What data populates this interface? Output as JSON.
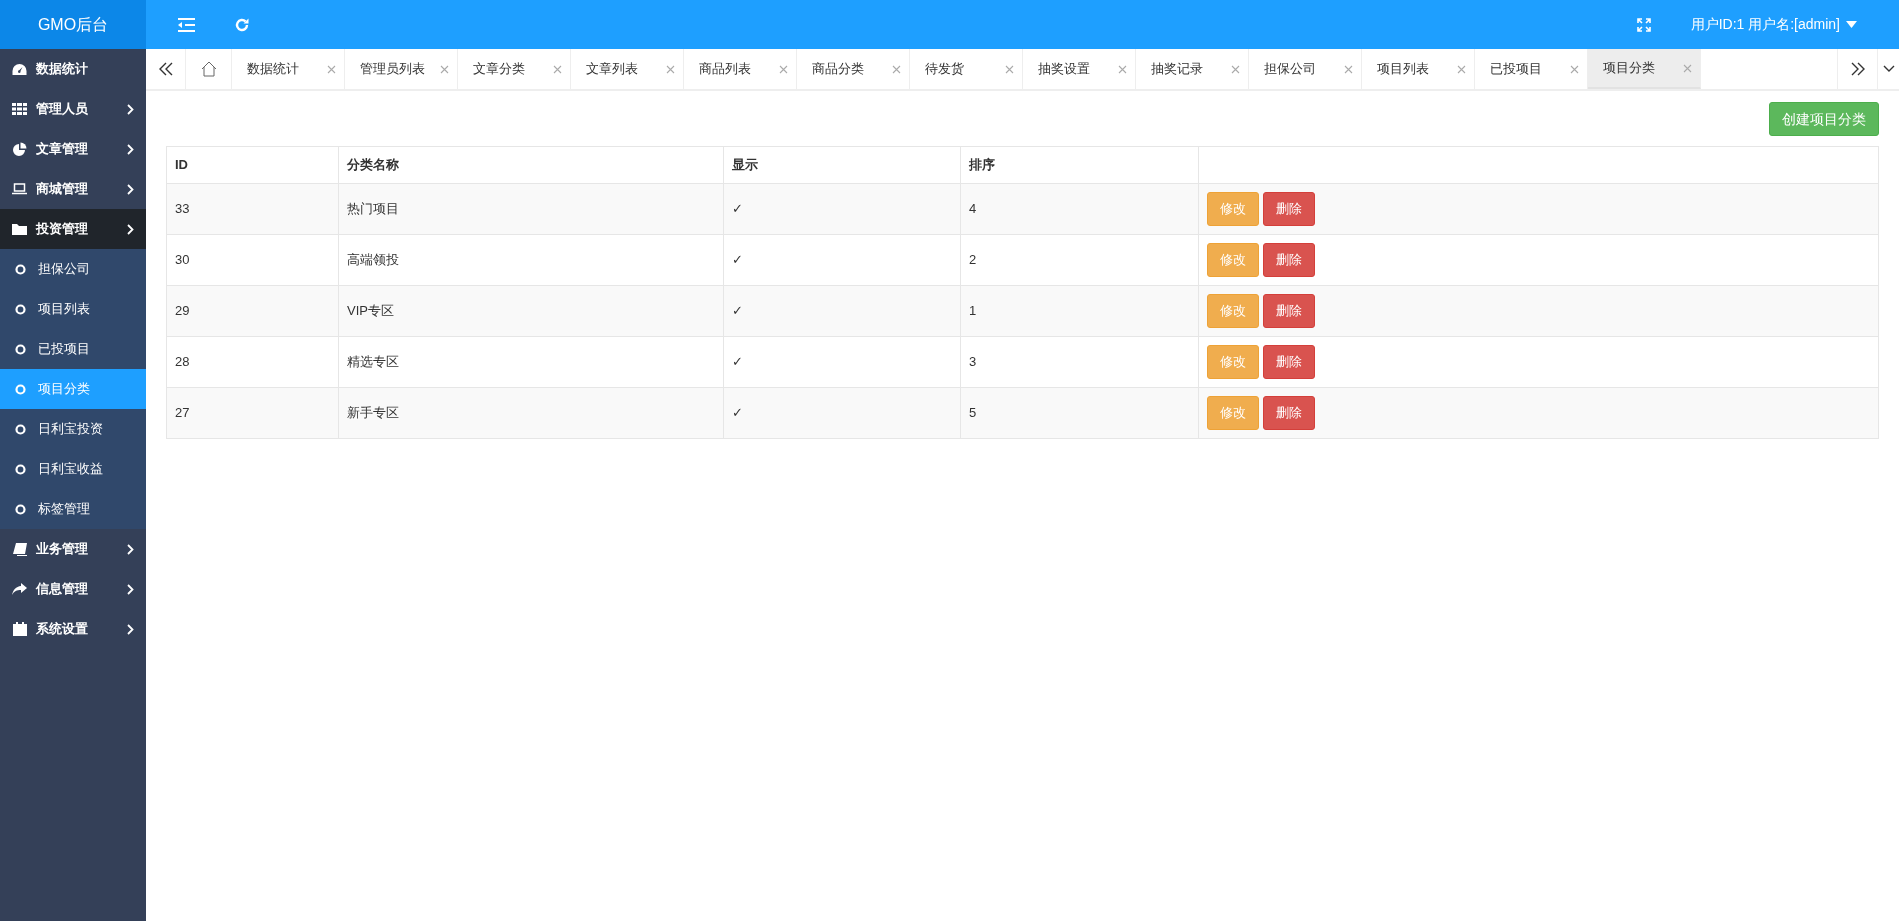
{
  "logo": "GMO后台",
  "user": {
    "label": "用户ID:1 用户名:[admin]"
  },
  "sidebar": {
    "items": [
      {
        "label": "数据统计",
        "expanded": false,
        "has_arrow": false
      },
      {
        "label": "管理人员",
        "expanded": false,
        "has_arrow": true
      },
      {
        "label": "文章管理",
        "expanded": false,
        "has_arrow": true
      },
      {
        "label": "商城管理",
        "expanded": false,
        "has_arrow": true
      },
      {
        "label": "投资管理",
        "expanded": true,
        "has_arrow": true,
        "children": [
          {
            "label": "担保公司",
            "selected": false
          },
          {
            "label": "项目列表",
            "selected": false
          },
          {
            "label": "已投项目",
            "selected": false
          },
          {
            "label": "项目分类",
            "selected": true
          },
          {
            "label": "日利宝投资",
            "selected": false
          },
          {
            "label": "日利宝收益",
            "selected": false
          },
          {
            "label": "标签管理",
            "selected": false
          }
        ]
      },
      {
        "label": "业务管理",
        "expanded": false,
        "has_arrow": true
      },
      {
        "label": "信息管理",
        "expanded": false,
        "has_arrow": true
      },
      {
        "label": "系统设置",
        "expanded": false,
        "has_arrow": true
      }
    ]
  },
  "tabs": [
    {
      "label": "数据统计",
      "selected": false
    },
    {
      "label": "管理员列表",
      "selected": false
    },
    {
      "label": "文章分类",
      "selected": false
    },
    {
      "label": "文章列表",
      "selected": false
    },
    {
      "label": "商品列表",
      "selected": false
    },
    {
      "label": "商品分类",
      "selected": false
    },
    {
      "label": "待发货",
      "selected": false
    },
    {
      "label": "抽奖设置",
      "selected": false
    },
    {
      "label": "抽奖记录",
      "selected": false
    },
    {
      "label": "担保公司",
      "selected": false
    },
    {
      "label": "项目列表",
      "selected": false
    },
    {
      "label": "已投项目",
      "selected": false
    },
    {
      "label": "项目分类",
      "selected": true
    }
  ],
  "create_button": "创建项目分类",
  "table": {
    "columns": [
      "ID",
      "分类名称",
      "显示",
      "排序"
    ],
    "rows": [
      {
        "id": "33",
        "name": "热门项目",
        "shown": "✓",
        "order": "4",
        "edit": "修改",
        "delete": "删除"
      },
      {
        "id": "30",
        "name": "高端领投",
        "shown": "✓",
        "order": "2",
        "edit": "修改",
        "delete": "删除"
      },
      {
        "id": "29",
        "name": "VIP专区",
        "shown": "✓",
        "order": "1",
        "edit": "修改",
        "delete": "删除"
      },
      {
        "id": "28",
        "name": "精选专区",
        "shown": "✓",
        "order": "3",
        "edit": "修改",
        "delete": "删除"
      },
      {
        "id": "27",
        "name": "新手专区",
        "shown": "✓",
        "order": "5",
        "edit": "修改",
        "delete": "删除"
      }
    ]
  }
}
